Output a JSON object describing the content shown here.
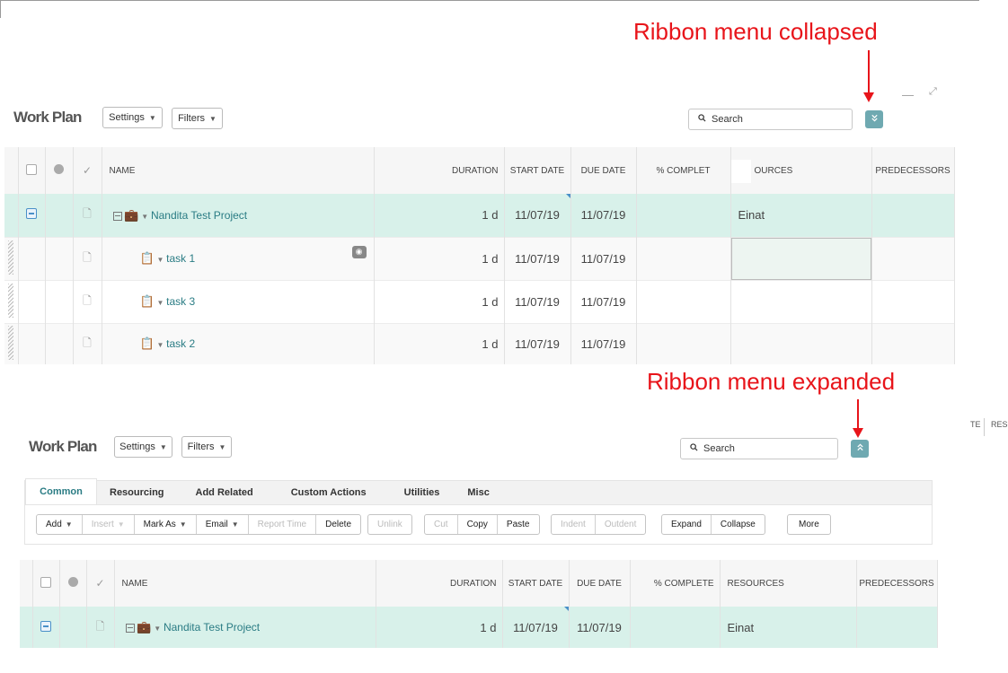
{
  "annotations": {
    "collapsed": "Ribbon menu collapsed",
    "expanded": "Ribbon menu expanded"
  },
  "colors": {
    "annotation": "#e8141a",
    "accent": "#6fa9b1",
    "link": "#2a7c84",
    "project_row": "#d8f1ea"
  },
  "work_plan": {
    "title": "Work Plan",
    "settings_label": "Settings",
    "filters_label": "Filters",
    "search_placeholder": "Search"
  },
  "columns": {
    "name": "NAME",
    "duration": "DURATION",
    "start_date": "START DATE",
    "due_date": "DUE DATE",
    "percent_complete": "% COMPLETE",
    "percent_complete_truncated": "% COMPLET",
    "resources": "RESOURCES",
    "resources_truncated": "OURCES",
    "predecessors": "PREDECESSORS"
  },
  "project": {
    "name": "Nandita Test Project",
    "duration": "1 d",
    "start": "11/07/19",
    "due": "11/07/19",
    "resources": "Einat"
  },
  "tasks": [
    {
      "name": "task 1",
      "duration": "1 d",
      "start": "11/07/19",
      "due": "11/07/19"
    },
    {
      "name": "task 3",
      "duration": "1 d",
      "start": "11/07/19",
      "due": "11/07/19"
    },
    {
      "name": "task 2",
      "duration": "1 d",
      "start": "11/07/19",
      "due": "11/07/19"
    }
  ],
  "ribbon": {
    "tabs": [
      "Common",
      "Resourcing",
      "Add Related",
      "Custom Actions",
      "Utilities",
      "Misc"
    ],
    "groups": {
      "g1": [
        {
          "label": "Add",
          "dropdown": true,
          "disabled": false
        },
        {
          "label": "Insert",
          "dropdown": true,
          "disabled": true
        },
        {
          "label": "Mark As",
          "dropdown": true,
          "disabled": false
        },
        {
          "label": "Email",
          "dropdown": true,
          "disabled": false
        },
        {
          "label": "Report Time",
          "dropdown": false,
          "disabled": true
        },
        {
          "label": "Delete",
          "dropdown": false,
          "disabled": false
        }
      ],
      "g2": [
        {
          "label": "Unlink",
          "disabled": true
        }
      ],
      "g3": [
        {
          "label": "Cut",
          "disabled": true
        },
        {
          "label": "Copy",
          "disabled": false
        },
        {
          "label": "Paste",
          "disabled": false
        }
      ],
      "g4": [
        {
          "label": "Indent",
          "disabled": true
        },
        {
          "label": "Outdent",
          "disabled": true
        }
      ],
      "g5": [
        {
          "label": "Expand",
          "disabled": false
        },
        {
          "label": "Collapse",
          "disabled": false
        }
      ],
      "g6": [
        {
          "label": "More",
          "disabled": false
        }
      ]
    }
  },
  "edge_fragment": {
    "left": "TE",
    "right": "RESO"
  }
}
